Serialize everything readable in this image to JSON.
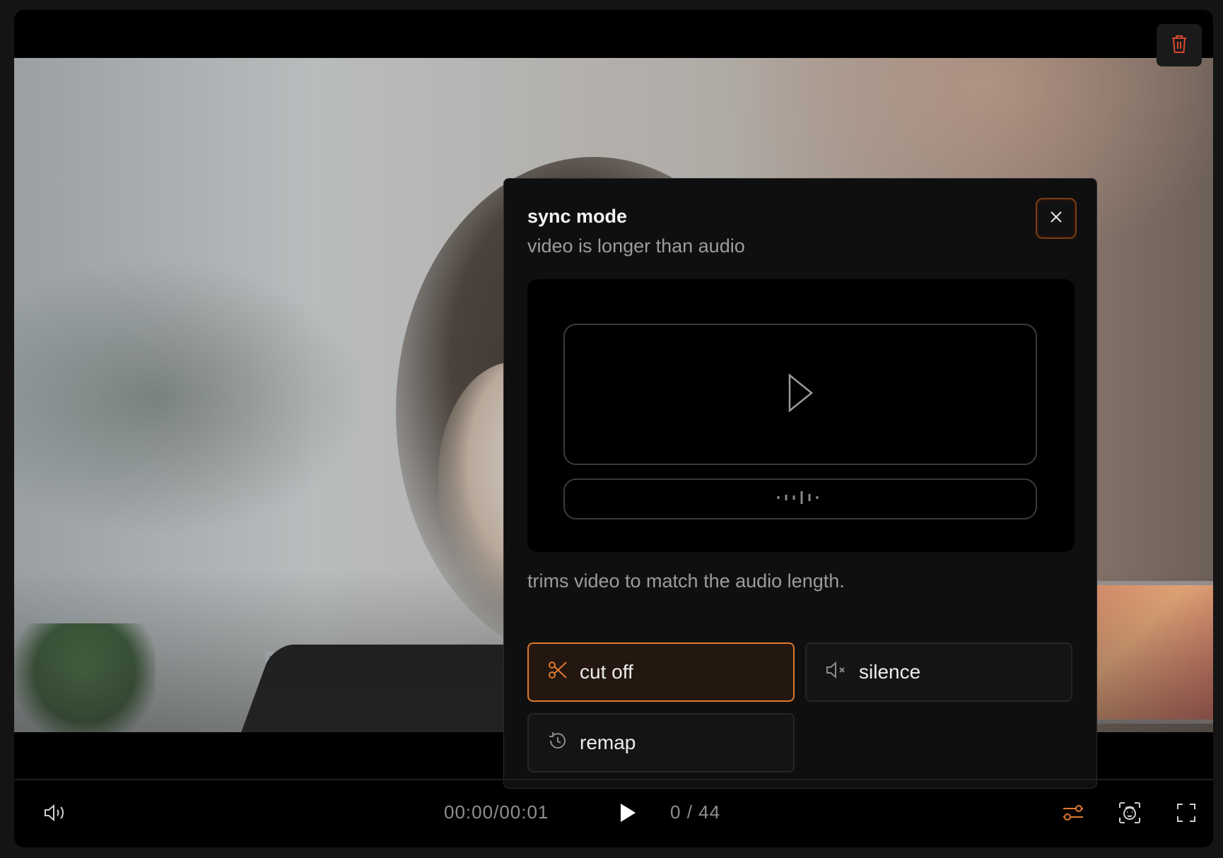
{
  "player": {
    "delete_icon": "trash-icon"
  },
  "sync_dialog": {
    "title": "sync mode",
    "subtitle": "video is longer than audio",
    "close_icon": "close-icon",
    "preview": {
      "video_icon": "play-outline-icon",
      "audio_icon": "waveform-icon"
    },
    "description": "trims video to match the audio length.",
    "options": [
      {
        "label": "cut off",
        "icon": "scissors-icon",
        "selected": true
      },
      {
        "label": "silence",
        "icon": "volume-mute-icon",
        "selected": false
      },
      {
        "label": "remap",
        "icon": "history-icon",
        "selected": false
      }
    ]
  },
  "controls": {
    "volume_icon": "volume-icon",
    "time_current": "00:00",
    "time_total": "00:01",
    "play_icon": "play-icon",
    "frame_current": "0",
    "frame_total": "44",
    "settings_icon": "sliders-icon",
    "face_icon": "face-scan-icon",
    "fullscreen_icon": "fullscreen-icon"
  },
  "colors": {
    "accent": "#e0782f",
    "danger": "#d9472f",
    "dialog_bg": "#0f0f10",
    "text_primary": "#f3f3f3",
    "text_muted": "#9c9c9c"
  }
}
